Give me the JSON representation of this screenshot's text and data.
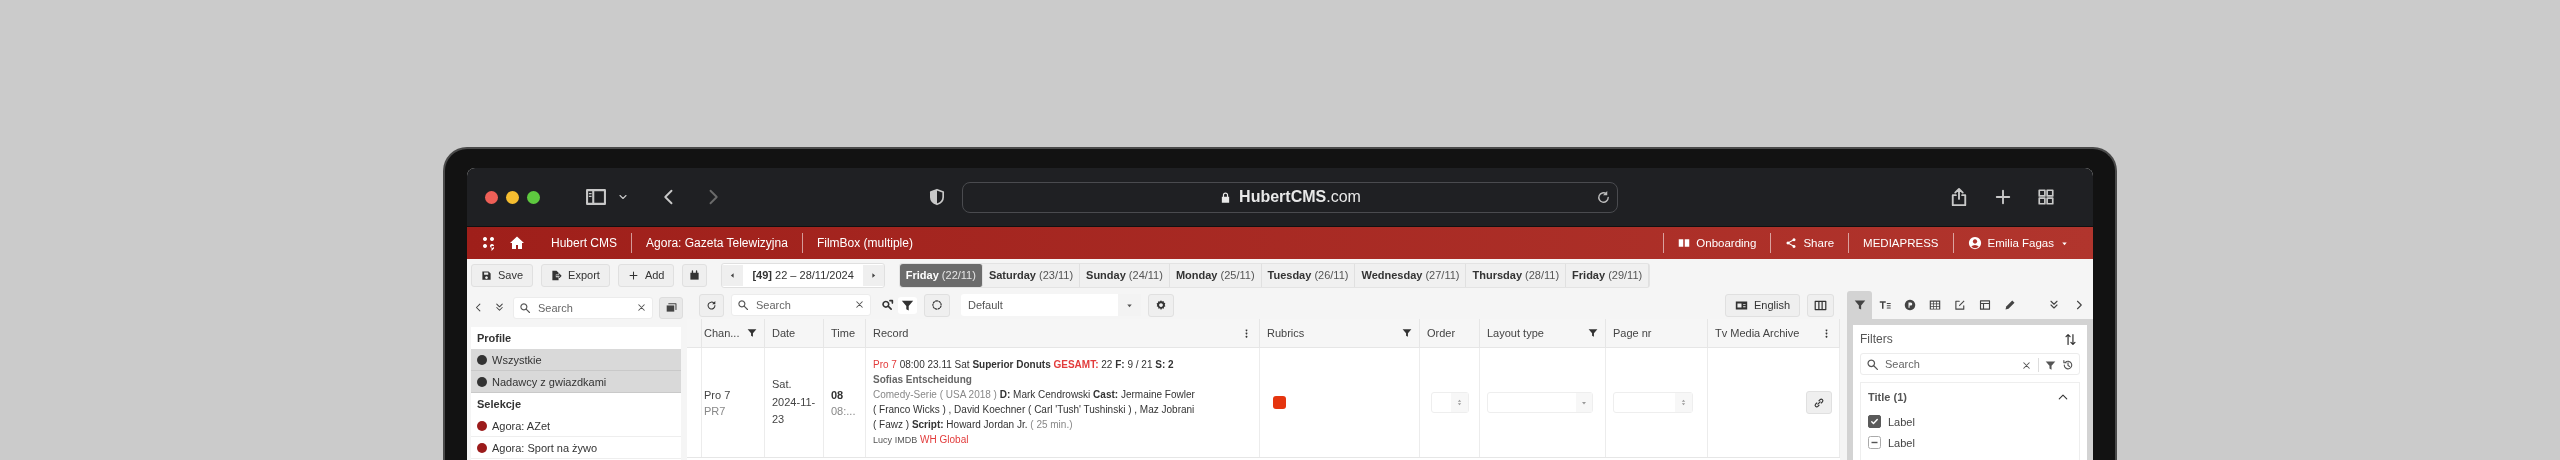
{
  "browser": {
    "address": "**HubertCMS**.com"
  },
  "header": {
    "breadcrumbs": [
      "Hubert CMS",
      "Agora: Gazeta Telewizyjna",
      "FilmBox (multiple)"
    ],
    "links": [
      "Onboarding",
      "Share",
      "MEDIAPRESS"
    ],
    "user": "Emilia Fagas"
  },
  "toolbar": {
    "actions": [
      "Save",
      "Export",
      "Add"
    ],
    "week": "**[49]** 22 – 28/11/2024",
    "days": [
      {
        "name": "Friday",
        "date": "(22/11)",
        "selected": true
      },
      {
        "name": "Saturday",
        "date": "(23/11)",
        "selected": false
      },
      {
        "name": "Sunday",
        "date": "(24/11)",
        "selected": false
      },
      {
        "name": "Monday",
        "date": "(25/11)",
        "selected": false
      },
      {
        "name": "Tuesday",
        "date": "(26/11)",
        "selected": false
      },
      {
        "name": "Wednesday",
        "date": "(27/11)",
        "selected": false
      },
      {
        "name": "Thursday",
        "date": "(28/11)",
        "selected": false
      },
      {
        "name": "Friday",
        "date": "(29/11)",
        "selected": false
      }
    ]
  },
  "sidebar": {
    "search": {
      "placeholder": "Search"
    },
    "sections": [
      {
        "title": "Profile",
        "items": [
          {
            "label": "Wszystkie",
            "selected": true,
            "color": "#333333"
          },
          {
            "label": "Nadawcy z gwiazdkami",
            "selected": true,
            "color": "#333333"
          }
        ]
      },
      {
        "title": "Selekcje",
        "items": [
          {
            "label": "Agora: AZet",
            "selected": false,
            "color": "#9b1b1b"
          },
          {
            "label": "Agora: Sport na żywo",
            "selected": false,
            "color": "#9b1b1b"
          }
        ]
      }
    ]
  },
  "grid_toolbar": {
    "search": {
      "placeholder": "Search"
    },
    "view": "Default",
    "language": "English"
  },
  "table": {
    "columns": [
      {
        "label": "Chan...",
        "filter": true,
        "menu": false
      },
      {
        "label": "Date",
        "filter": false,
        "menu": false
      },
      {
        "label": "Time",
        "filter": false,
        "menu": false
      },
      {
        "label": "Record",
        "filter": false,
        "menu": true
      },
      {
        "label": "Rubrics",
        "filter": true,
        "menu": false
      },
      {
        "label": "Order",
        "filter": false,
        "menu": false
      },
      {
        "label": "Layout type",
        "filter": true,
        "menu": false
      },
      {
        "label": "Page nr",
        "filter": false,
        "menu": false
      },
      {
        "label": "Tv Media Archive",
        "filter": false,
        "menu": true
      }
    ],
    "rows": [
      {
        "channel": "Pro 7",
        "channel_code": "PR7",
        "date": "Sat. 2024-11-23",
        "hour": "08",
        "time": "08:...",
        "rubrics": [
          {
            "color": "#e5350f"
          }
        ],
        "record": [
          [
            {
              "text": "Pro 7",
              "kind": "accent"
            },
            {
              "text": "08:00",
              "kind": "plain"
            },
            {
              "text": "23.11",
              "kind": "plain"
            },
            {
              "text": "Sat",
              "kind": "plain"
            },
            {
              "text": "Superior Donuts",
              "kind": "bold"
            },
            {
              "text": "GESAMT:",
              "kind": "accent-bold"
            },
            {
              "text": "22",
              "kind": "plain"
            },
            {
              "text": "F:",
              "kind": "bold"
            },
            {
              "text": "9 / 21",
              "kind": "plain"
            },
            {
              "text": "S:",
              "kind": "bold"
            },
            {
              "text": "2",
              "kind": "bold"
            }
          ],
          [
            {
              "text": "Sofias Entscheidung",
              "kind": "subtitle"
            }
          ],
          [
            {
              "text": "Comedy-Serie ( USA 2018 )",
              "kind": "muted"
            },
            {
              "text": "D:",
              "kind": "bold"
            },
            {
              "text": "Mark Cendrowski",
              "kind": "plain"
            },
            {
              "text": "Cast:",
              "kind": "bold"
            },
            {
              "text": "Jermaine Fowler",
              "kind": "plain"
            }
          ],
          [
            {
              "text": "( Franco Wicks ) , David Koechner ( Carl 'Tush' Tushinski ) , Maz Jobrani",
              "kind": "plain"
            }
          ],
          [
            {
              "text": "( Fawz )",
              "kind": "plain"
            },
            {
              "text": "Script:",
              "kind": "bold"
            },
            {
              "text": "Howard Jordan Jr.",
              "kind": "plain"
            },
            {
              "text": "( 25 min.)",
              "kind": "muted"
            }
          ],
          [
            {
              "text": "Lucy",
              "kind": "small"
            },
            {
              "text": "IMDB",
              "kind": "small"
            },
            {
              "text": "WH Global",
              "kind": "accent"
            }
          ]
        ]
      }
    ]
  },
  "filters_panel": {
    "tabs": [
      {
        "selected": true
      },
      {
        "selected": false
      },
      {
        "selected": false
      },
      {
        "selected": false
      },
      {
        "selected": false
      },
      {
        "selected": false
      },
      {
        "selected": false
      }
    ],
    "title": "Filters",
    "search": {
      "placeholder": "Search"
    },
    "group": {
      "title": "Title (1)",
      "expanded": true,
      "options": [
        {
          "label": "Label",
          "kind": "checkbox",
          "checked": true
        },
        {
          "label": "Label",
          "kind": "mixed"
        }
      ]
    }
  }
}
